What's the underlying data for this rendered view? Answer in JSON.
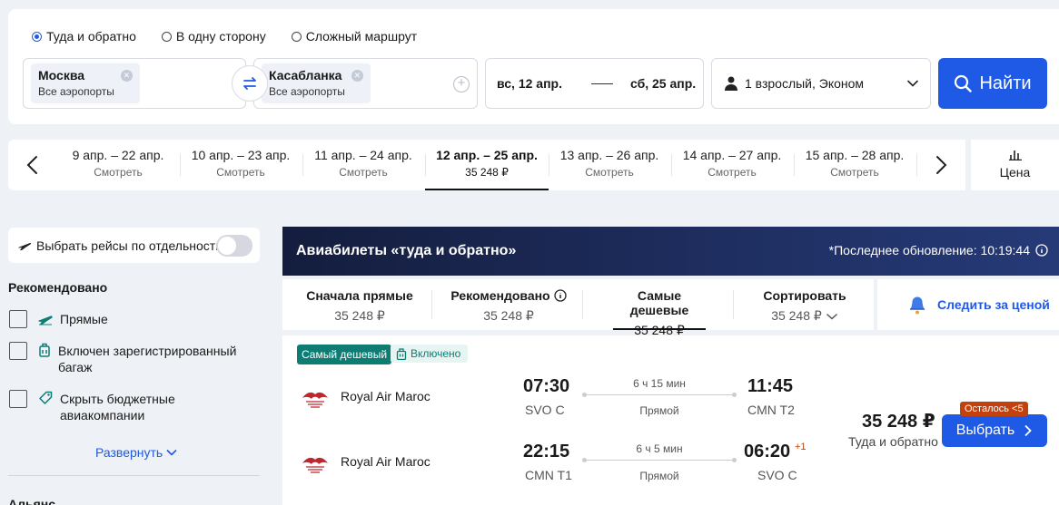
{
  "search": {
    "trip_types": [
      {
        "label": "Туда и обратно",
        "selected": true
      },
      {
        "label": "В одну сторону",
        "selected": false
      },
      {
        "label": "Сложный маршрут",
        "selected": false
      }
    ],
    "origin": {
      "city": "Москва",
      "airports": "Все аэропорты"
    },
    "destination": {
      "city": "Касабланка",
      "airports": "Все аэропорты"
    },
    "depart_date": "вс, 12 апр.",
    "return_date": "сб, 25 апр.",
    "passengers": "1 взрослый, Эконом",
    "find_label": "Найти",
    "accent_color": "#1e5ae6"
  },
  "date_strip": {
    "items": [
      {
        "range": "9 апр. – 22 апр.",
        "sub": "Смотреть",
        "active": false
      },
      {
        "range": "10 апр. – 23 апр.",
        "sub": "Смотреть",
        "active": false
      },
      {
        "range": "11 апр. – 24 апр.",
        "sub": "Смотреть",
        "active": false
      },
      {
        "range": "12 апр. – 25 апр.",
        "sub": "35 248 ₽",
        "active": true
      },
      {
        "range": "13 апр. – 26 апр.",
        "sub": "Смотреть",
        "active": false
      },
      {
        "range": "14 апр. – 27 апр.",
        "sub": "Смотреть",
        "active": false
      },
      {
        "range": "15 апр. – 28 апр.",
        "sub": "Смотреть",
        "active": false
      }
    ],
    "price_label": "Цена"
  },
  "sidebar": {
    "toggle_label": "Выбрать рейсы по отдельности",
    "heading": "Рекомендовано",
    "filters": [
      {
        "label": "Прямые",
        "icon": "plane-icon"
      },
      {
        "label": "Включен зарегистрированный багаж",
        "icon": "luggage-icon"
      },
      {
        "label": "Скрыть бюджетные авиакомпании",
        "icon": "tag-icon"
      }
    ],
    "expand_label": "Развернуть",
    "next_heading": "Альянс"
  },
  "results": {
    "banner_title": "Авиабилеты «туда и обратно»",
    "last_update": "*Последнее обновление: 10:19:44",
    "sort_tabs": [
      {
        "label": "Сначала прямые",
        "price": "35 248 ₽",
        "active": false
      },
      {
        "label": "Рекомендовано",
        "price": "35 248 ₽",
        "active": false
      },
      {
        "label": "Самые дешевые",
        "price": "35 248 ₽",
        "active": true
      },
      {
        "label": "Сортировать",
        "price": "35 248 ₽",
        "active": false
      }
    ],
    "watch_label": "Следить за ценой",
    "card": {
      "badge": "Самый дешевый",
      "baggage": "Включено",
      "legs": [
        {
          "airline": "Royal Air Maroc",
          "dep_time": "07:30",
          "dep_airport": "SVO C",
          "duration": "6 ч 15 мин",
          "stops": "Прямой",
          "arr_time": "11:45",
          "arr_airport": "CMN T2",
          "plus_day": ""
        },
        {
          "airline": "Royal Air Maroc",
          "dep_time": "22:15",
          "dep_airport": "CMN T1",
          "duration": "6 ч 5 мин",
          "stops": "Прямой",
          "arr_time": "06:20",
          "arr_airport": "SVO C",
          "plus_day": "+1"
        }
      ],
      "price": "35 248 ₽",
      "price_note": "Туда и обратно",
      "seats_left": "Осталось <5",
      "select_label": "Выбрать"
    }
  }
}
